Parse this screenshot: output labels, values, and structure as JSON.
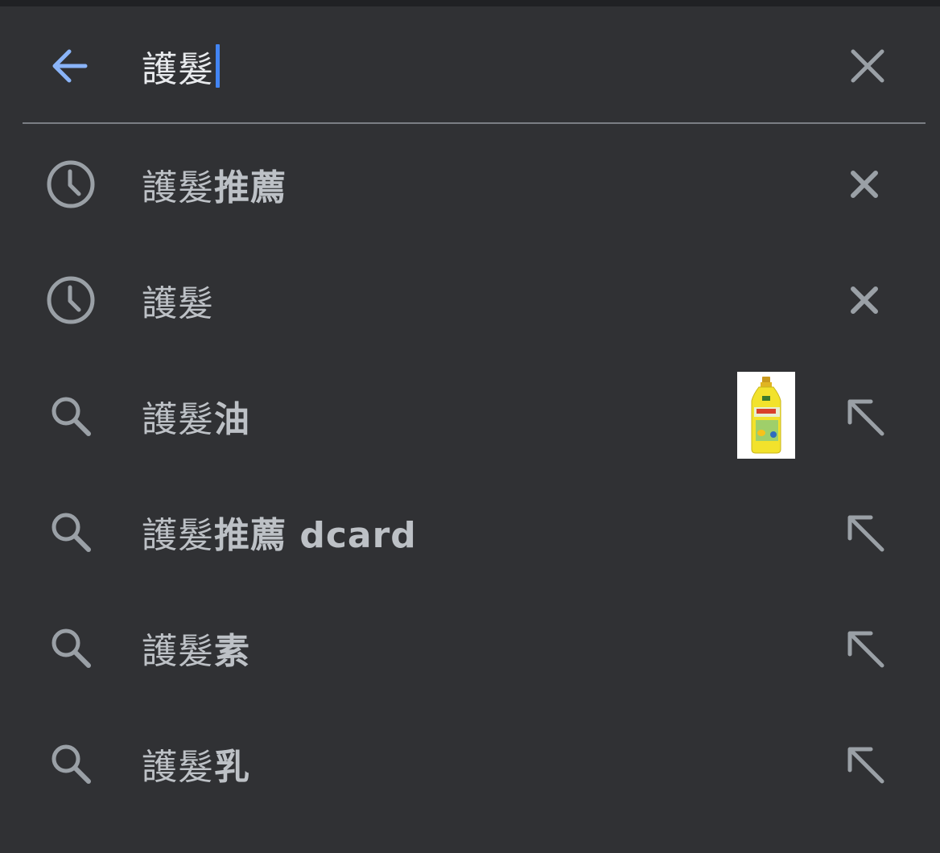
{
  "search": {
    "query": "護髮"
  },
  "suggestions": [
    {
      "type": "history",
      "prefix": "護髮",
      "suffix": "推薦"
    },
    {
      "type": "history",
      "prefix": "護髮",
      "suffix": ""
    },
    {
      "type": "search",
      "prefix": "護髮",
      "suffix": "油",
      "has_thumbnail": true
    },
    {
      "type": "search",
      "prefix": "護髮",
      "suffix": "推薦 dcard"
    },
    {
      "type": "search",
      "prefix": "護髮",
      "suffix": "素"
    },
    {
      "type": "search",
      "prefix": "護髮",
      "suffix": "乳"
    }
  ],
  "colors": {
    "background": "#303134",
    "caret": "#4285f4",
    "back_arrow": "#8ab4f8",
    "icon_gray": "#9aa0a6",
    "text": "#bdc1c6"
  },
  "icons": {
    "back": "arrow-left-icon",
    "clear": "close-icon",
    "history": "clock-icon",
    "search": "search-icon",
    "remove": "close-icon",
    "fill_query": "arrow-up-left-icon"
  }
}
